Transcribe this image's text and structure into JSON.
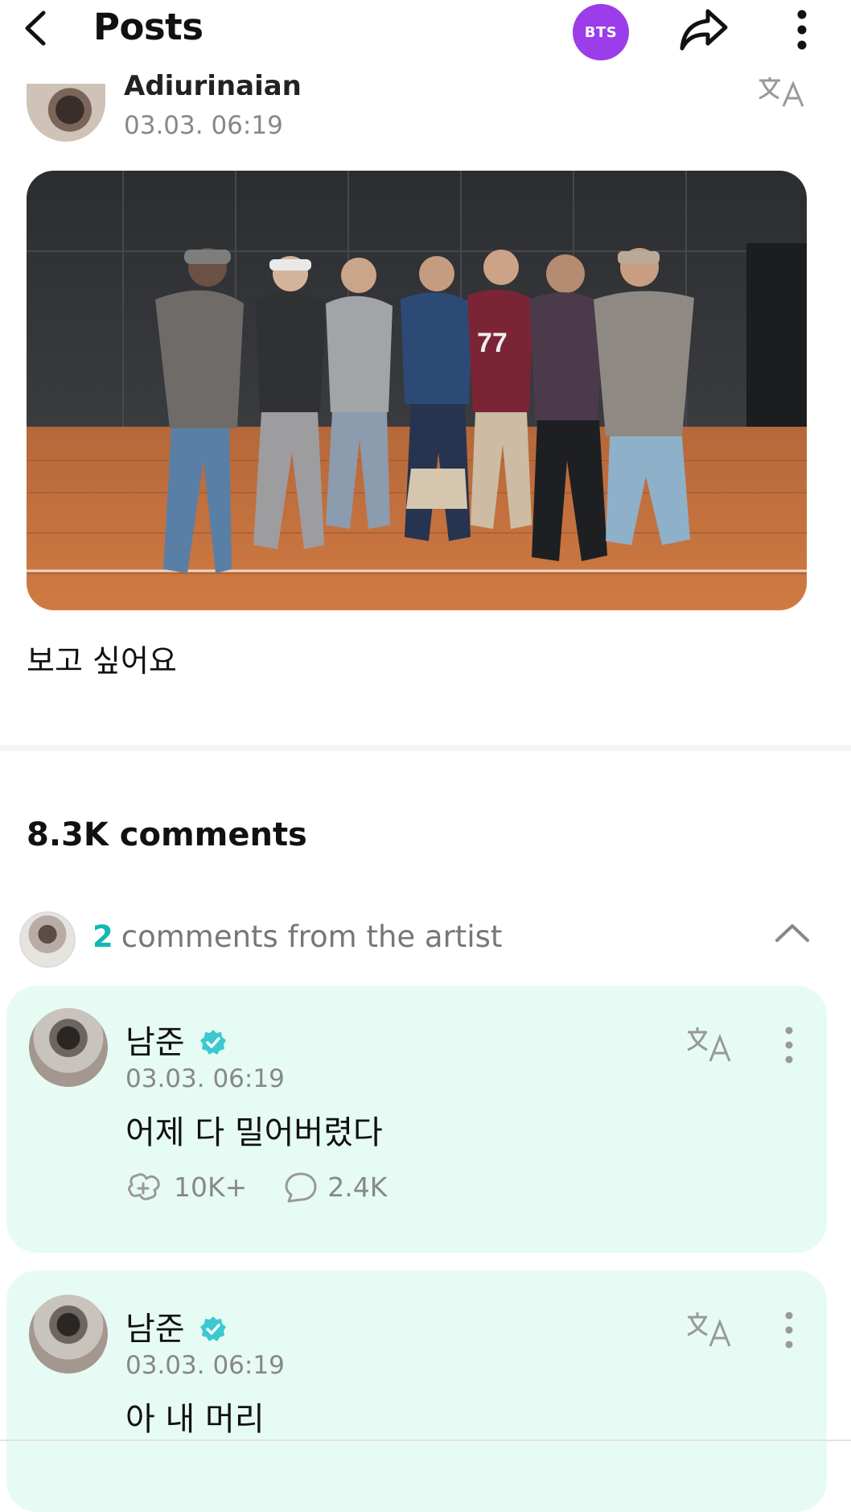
{
  "header": {
    "title": "Posts",
    "community_badge": "BTS"
  },
  "post": {
    "author": "Adiurinaian",
    "timestamp": "03.03. 06:19",
    "text": "보고 싶어요"
  },
  "comments": {
    "count_label": "8.3K comments",
    "artist_strip": {
      "count": "2",
      "label": "comments from the artist"
    },
    "items": [
      {
        "author": "남준",
        "timestamp": "03.03. 06:19",
        "text": "어제 다 밀어버렸다",
        "likes": "10K+",
        "replies": "2.4K"
      },
      {
        "author": "남준",
        "timestamp": "03.03. 06:19",
        "text": "아 내 머리"
      }
    ]
  },
  "colors": {
    "badge": "#9b3de8",
    "accent_teal": "#14b8b0",
    "card_bg": "#e7fbf5",
    "verified": "#3bc9cf"
  }
}
